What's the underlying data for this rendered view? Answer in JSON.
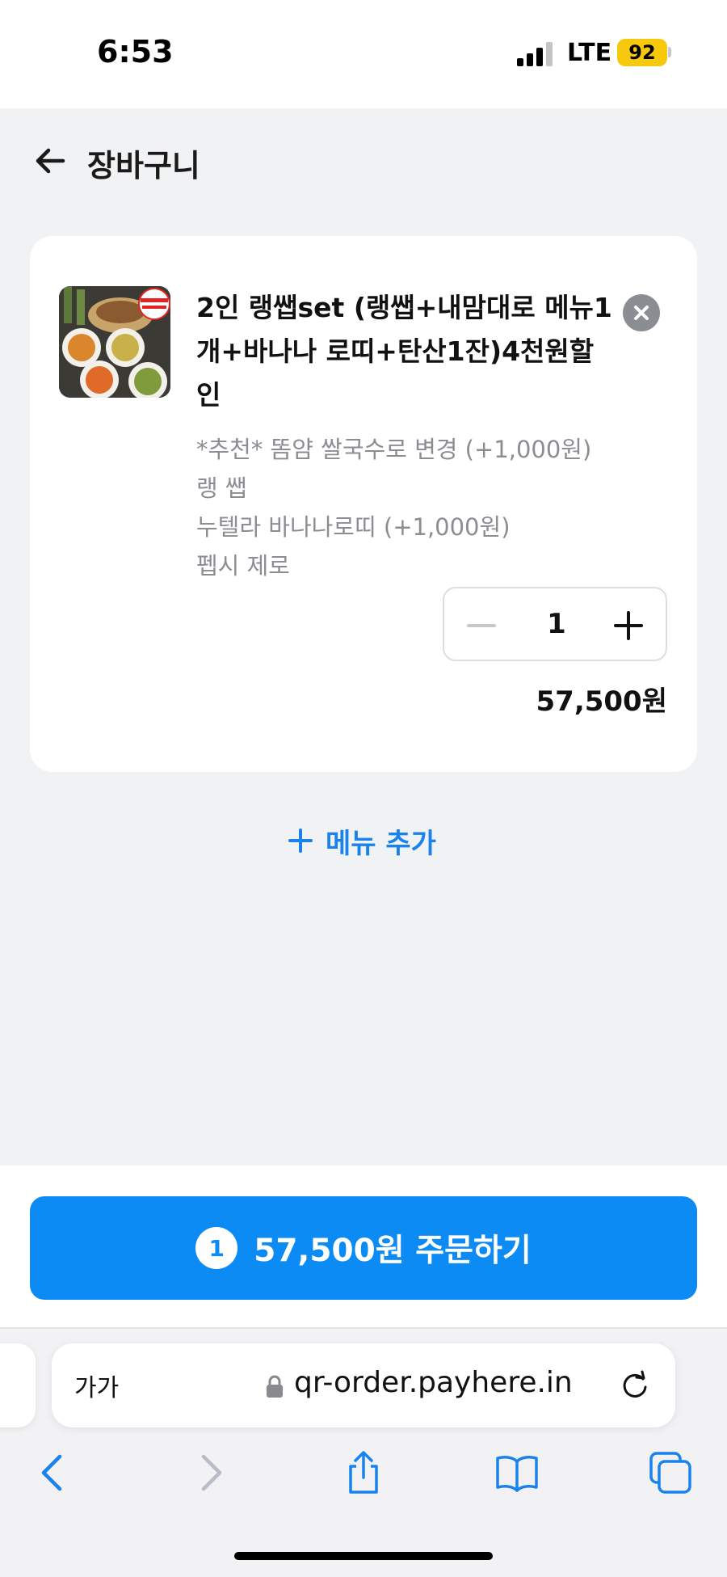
{
  "status_bar": {
    "time": "6:53",
    "network": "LTE",
    "battery": "92"
  },
  "header": {
    "title": "장바구니"
  },
  "cart": {
    "item": {
      "name": "2인 랭쌥set (랭쌥+내맘대로 메뉴1개+바나나 로띠+탄산1잔)4천원할인",
      "thumb_badge": "대내 4,000원 할인",
      "options": [
        "*추천* 똠얌 쌀국수로 변경 (+1,000원)",
        "랭 쌥",
        "누텔라 바나나로띠 (+1,000원)",
        "펩시 제로"
      ],
      "quantity": "1",
      "price": "57,500원"
    },
    "add_menu_label": "메뉴 추가"
  },
  "order": {
    "count": "1",
    "label": "57,500원 주문하기"
  },
  "browser": {
    "text_size_label": "가가",
    "url": "qr-order.payhere.in"
  },
  "colors": {
    "accent": "#0d8bf5",
    "link": "#1a82ec",
    "battery": "#f7c90c",
    "background": "#f1f2f4"
  },
  "icons": {
    "back": "arrow-left-icon",
    "remove": "close-circle-icon",
    "minus": "minus-icon",
    "plus": "plus-icon",
    "lock": "lock-icon",
    "reload": "reload-icon",
    "nav_back": "chevron-left-icon",
    "nav_forward": "chevron-right-icon",
    "share": "share-icon",
    "bookmarks": "book-icon",
    "tabs": "tabs-icon"
  }
}
